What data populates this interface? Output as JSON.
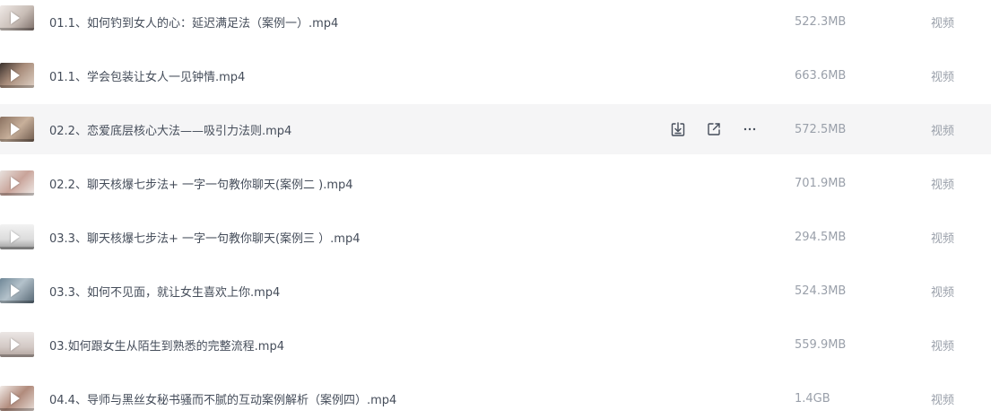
{
  "files": [
    {
      "name": "01.1、如何钓到女人的心：延迟满足法（案例一）.mp4",
      "size": "522.3MB",
      "type": "视频",
      "thumbnail": "video-thumbnail"
    },
    {
      "name": "01.1、学会包装让女人一见钟情.mp4",
      "size": "663.6MB",
      "type": "视频",
      "thumbnail": "video-thumbnail"
    },
    {
      "name": "02.2、恋爱底层核心大法——吸引力法则.mp4",
      "size": "572.5MB",
      "type": "视频",
      "thumbnail": "video-thumbnail",
      "hovered": true
    },
    {
      "name": "02.2、聊天核爆七步法+ 一字一句教你聊天(案例二 ).mp4",
      "size": "701.9MB",
      "type": "视频",
      "thumbnail": "video-thumbnail"
    },
    {
      "name": "03.3、聊天核爆七步法+ 一字一句教你聊天(案例三 ）.mp4",
      "size": "294.5MB",
      "type": "视频",
      "thumbnail": "video-thumbnail"
    },
    {
      "name": "03.3、如何不见面，就让女生喜欢上你.mp4",
      "size": "524.3MB",
      "type": "视频",
      "thumbnail": "video-thumbnail"
    },
    {
      "name": "03.如何跟女生从陌生到熟悉的完整流程.mp4",
      "size": "559.9MB",
      "type": "视频",
      "thumbnail": "video-thumbnail"
    },
    {
      "name": "04.4、导师与黑丝女秘书骚而不腻的互动案例解析（案例四）.mp4",
      "size": "1.4GB",
      "type": "视频",
      "thumbnail": "video-thumbnail"
    }
  ],
  "row_actions": {
    "download_icon": "download-icon",
    "share_icon": "share-icon",
    "more_icon": "more-icon"
  },
  "colors": {
    "hover_row_bg": "#f5f5f6",
    "name_text": "#454d5a",
    "meta_text": "#9aa0aa",
    "icon": "#454d5a"
  }
}
